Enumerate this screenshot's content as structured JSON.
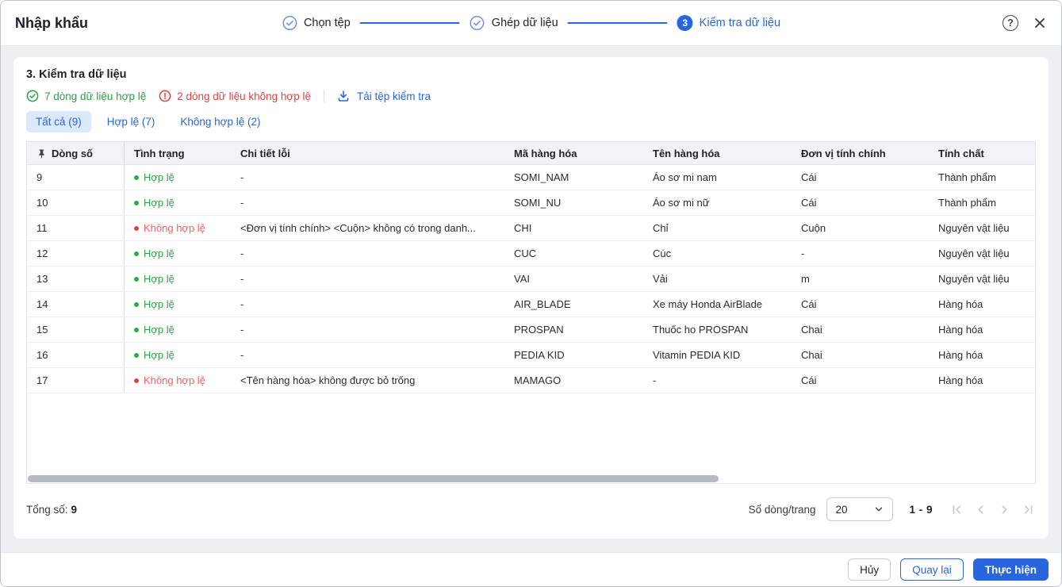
{
  "window": {
    "title": "Nhập khẩu"
  },
  "stepper": {
    "steps": [
      {
        "label": "Chọn tệp",
        "state": "done"
      },
      {
        "label": "Ghép dữ liệu",
        "state": "done"
      },
      {
        "label": "Kiểm tra dữ liệu",
        "state": "active",
        "number": "3"
      }
    ]
  },
  "section": {
    "title": "3. Kiểm tra dữ liệu",
    "valid_summary": "7 dòng dữ liệu hợp lệ",
    "invalid_summary": "2 dòng dữ liệu không hợp lệ",
    "download_label": "Tải tệp kiểm tra"
  },
  "tabs": [
    {
      "label": "Tất cả (9)",
      "active": true
    },
    {
      "label": "Hợp lệ (7)",
      "active": false
    },
    {
      "label": "Không hợp lệ (2)",
      "active": false
    }
  ],
  "table": {
    "columns": [
      "Dòng số",
      "Tình trạng",
      "Chi tiết lỗi",
      "Mã hàng hóa",
      "Tên hàng hóa",
      "Đơn vị tính chính",
      "Tính chất"
    ],
    "rows": [
      {
        "line": "9",
        "status": "Hợp lệ",
        "valid": true,
        "error": "-",
        "code": "SOMI_NAM",
        "name": "Áo sơ mi nam",
        "unit": "Cái",
        "nature": "Thành phẩm"
      },
      {
        "line": "10",
        "status": "Hợp lệ",
        "valid": true,
        "error": "-",
        "code": "SOMI_NU",
        "name": "Áo sơ mi nữ",
        "unit": "Cái",
        "nature": "Thành phẩm"
      },
      {
        "line": "11",
        "status": "Không hợp lệ",
        "valid": false,
        "error": "<Đơn vị tính chính> <Cuộn> không có trong danh...",
        "code": "CHI",
        "name": "Chỉ",
        "unit": "Cuộn",
        "nature": "Nguyên vật liệu"
      },
      {
        "line": "12",
        "status": "Hợp lệ",
        "valid": true,
        "error": "-",
        "code": "CUC",
        "name": "Cúc",
        "unit": "-",
        "nature": "Nguyên vật liệu"
      },
      {
        "line": "13",
        "status": "Hợp lệ",
        "valid": true,
        "error": "-",
        "code": "VAI",
        "name": "Vải",
        "unit": "m",
        "nature": "Nguyên vật liệu"
      },
      {
        "line": "14",
        "status": "Hợp lệ",
        "valid": true,
        "error": "-",
        "code": "AIR_BLADE",
        "name": "Xe máy Honda AirBlade",
        "unit": "Cái",
        "nature": "Hàng hóa"
      },
      {
        "line": "15",
        "status": "Hợp lệ",
        "valid": true,
        "error": "-",
        "code": "PROSPAN",
        "name": "Thuốc ho PROSPAN",
        "unit": "Chai",
        "nature": "Hàng hóa"
      },
      {
        "line": "16",
        "status": "Hợp lệ",
        "valid": true,
        "error": "-",
        "code": "PEDIA KID",
        "name": "Vitamin PEDIA KID",
        "unit": "Chai",
        "nature": "Hàng hóa"
      },
      {
        "line": "17",
        "status": "Không hợp lệ",
        "valid": false,
        "error": "<Tên hàng hóa> không được bỏ trống",
        "code": "MAMAGO",
        "name": "-",
        "unit": "Cái",
        "nature": "Hàng hóa"
      }
    ]
  },
  "pagination": {
    "total_label": "Tổng số:",
    "total_value": "9",
    "per_page_label": "Số dòng/trang",
    "per_page_value": "20",
    "range": "1 - 9"
  },
  "footer": {
    "cancel": "Hủy",
    "back": "Quay lại",
    "submit": "Thực hiện"
  },
  "colors": {
    "accent": "#2766dd",
    "valid_green": "#2f9e4a",
    "invalid_red": "#e5413e",
    "invalid_row_text": "#f0615e",
    "tab_active_bg": "#dce8fb",
    "table_header_bg": "#f2f3f6"
  }
}
